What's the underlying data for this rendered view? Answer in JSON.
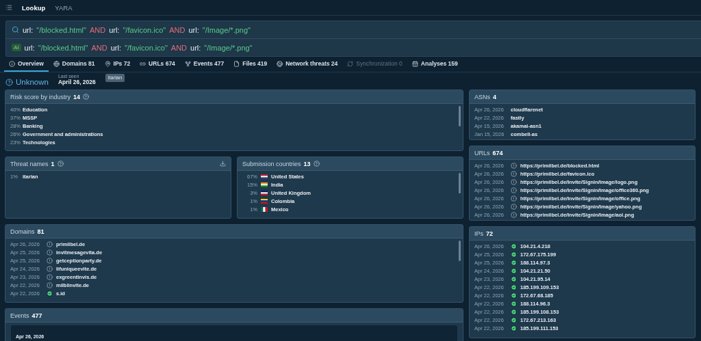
{
  "nav": {
    "tabs": [
      {
        "label": "Lookup",
        "selected": true
      },
      {
        "label": "YARA",
        "selected": false
      }
    ]
  },
  "query": [
    {
      "kind": "field",
      "text": "url:"
    },
    {
      "kind": "value",
      "text": "\"/blocked.html\""
    },
    {
      "kind": "op",
      "text": "AND"
    },
    {
      "kind": "field",
      "text": "url:"
    },
    {
      "kind": "value",
      "text": "\"/favicon.ico\""
    },
    {
      "kind": "op",
      "text": "AND"
    },
    {
      "kind": "field",
      "text": "url:"
    },
    {
      "kind": "value",
      "text": "\"/Image/*.png\""
    }
  ],
  "suggestion": {
    "badge": "AI",
    "tokens": [
      {
        "kind": "field",
        "text": "url:"
      },
      {
        "kind": "value",
        "text": "\"/blocked.html\""
      },
      {
        "kind": "op",
        "text": "AND"
      },
      {
        "kind": "field",
        "text": "url:"
      },
      {
        "kind": "value",
        "text": "\"/favicon.ico\""
      },
      {
        "kind": "op",
        "text": "AND"
      },
      {
        "kind": "field",
        "text": "url:"
      },
      {
        "kind": "value",
        "text": "\"/Image/*.png\""
      }
    ]
  },
  "tabs": [
    {
      "label": "Overview",
      "selected": true,
      "disabled": false
    },
    {
      "label": "Domains 81",
      "selected": false,
      "disabled": false
    },
    {
      "label": "IPs 72",
      "selected": false,
      "disabled": false
    },
    {
      "label": "URLs 674",
      "selected": false,
      "disabled": false
    },
    {
      "label": "Events 477",
      "selected": false,
      "disabled": false
    },
    {
      "label": "Files 419",
      "selected": false,
      "disabled": false
    },
    {
      "label": "Network threats 24",
      "selected": false,
      "disabled": false
    },
    {
      "label": "Synchronization 0",
      "selected": false,
      "disabled": true
    },
    {
      "label": "Analyses 159",
      "selected": false,
      "disabled": false
    }
  ],
  "summary": {
    "verdict": "Unknown",
    "last_seen_label": "Last seen",
    "last_seen": "April 26, 2026",
    "tag": "itarian"
  },
  "risk": {
    "title": "Risk score by industry",
    "count": "14",
    "rows": [
      {
        "pct": "40%",
        "name": "Education"
      },
      {
        "pct": "37%",
        "name": "MSSP"
      },
      {
        "pct": "28%",
        "name": "Banking"
      },
      {
        "pct": "26%",
        "name": "Government and administrations"
      },
      {
        "pct": "23%",
        "name": "Technologies"
      }
    ]
  },
  "threat_names": {
    "title": "Threat names",
    "count": "1",
    "rows": [
      {
        "pct": "1%",
        "name": "itarian"
      }
    ]
  },
  "countries": {
    "title": "Submission countries",
    "count": "13",
    "rows": [
      {
        "pct": "67%",
        "name": "United States"
      },
      {
        "pct": "15%",
        "name": "India"
      },
      {
        "pct": "3%",
        "name": "United Kingdom"
      },
      {
        "pct": "1%",
        "name": "Colombia"
      },
      {
        "pct": "1%",
        "name": "Mexico"
      }
    ]
  },
  "domains": {
    "title": "Domains",
    "count": "81",
    "rows": [
      {
        "date": "Apr 26, 2026",
        "clean": false,
        "name": "primilbel.de"
      },
      {
        "date": "Apr 25, 2026",
        "clean": false,
        "name": "invitmesagevita.de"
      },
      {
        "date": "Apr 25, 2026",
        "clean": false,
        "name": "getceptionparty.de"
      },
      {
        "date": "Apr 24, 2026",
        "clean": false,
        "name": "lifuniqueevite.de"
      },
      {
        "date": "Apr 23, 2026",
        "clean": false,
        "name": "exgreentinvis.de"
      },
      {
        "date": "Apr 22, 2026",
        "clean": false,
        "name": "milblinvite.de"
      },
      {
        "date": "Apr 22, 2026",
        "clean": true,
        "name": "s.id"
      }
    ]
  },
  "events": {
    "title": "Events",
    "count": "477",
    "first_date": "Apr 26, 2026"
  },
  "asns": {
    "title": "ASNs",
    "count": "4",
    "rows": [
      {
        "date": "Apr 26, 2026",
        "name": "cloudflarenet"
      },
      {
        "date": "Apr 22, 2026",
        "name": "fastly"
      },
      {
        "date": "Apr 15, 2026",
        "name": "akamai-asn1"
      },
      {
        "date": "Jan 15, 2026",
        "name": "combell-as"
      }
    ]
  },
  "urls": {
    "title": "URLs",
    "count": "674",
    "rows": [
      {
        "date": "Apr 26, 2026",
        "clean": false,
        "name": "https://primilbel.de/blocked.html"
      },
      {
        "date": "Apr 26, 2026",
        "clean": false,
        "name": "https://primilbel.de/favicon.ico"
      },
      {
        "date": "Apr 26, 2026",
        "clean": false,
        "name": "https://primilbel.de/Invite/Signin/Image/logo.png"
      },
      {
        "date": "Apr 26, 2026",
        "clean": false,
        "name": "https://primilbel.de/Invite/Signin/Image/office360.png"
      },
      {
        "date": "Apr 26, 2026",
        "clean": false,
        "name": "https://primilbel.de/Invite/Signin/Image/office.png"
      },
      {
        "date": "Apr 26, 2026",
        "clean": false,
        "name": "https://primilbel.de/Invite/Signin/Image/yahoo.png"
      },
      {
        "date": "Apr 26, 2026",
        "clean": false,
        "name": "https://primilbel.de/Invite/Signin/Image/aol.png"
      }
    ]
  },
  "ips": {
    "title": "IPs",
    "count": "72",
    "rows": [
      {
        "date": "Apr 26, 2026",
        "clean": true,
        "name": "104.21.4.218"
      },
      {
        "date": "Apr 25, 2026",
        "clean": true,
        "name": "172.67.175.199"
      },
      {
        "date": "Apr 25, 2026",
        "clean": true,
        "name": "188.114.97.3"
      },
      {
        "date": "Apr 24, 2026",
        "clean": true,
        "name": "104.21.21.50"
      },
      {
        "date": "Apr 23, 2026",
        "clean": true,
        "name": "104.21.95.14"
      },
      {
        "date": "Apr 22, 2026",
        "clean": true,
        "name": "185.199.109.153"
      },
      {
        "date": "Apr 22, 2026",
        "clean": true,
        "name": "172.67.68.185"
      },
      {
        "date": "Apr 22, 2026",
        "clean": true,
        "name": "188.114.96.3"
      },
      {
        "date": "Apr 22, 2026",
        "clean": true,
        "name": "185.199.108.153"
      },
      {
        "date": "Apr 22, 2026",
        "clean": true,
        "name": "172.67.213.163"
      },
      {
        "date": "Apr 22, 2026",
        "clean": true,
        "name": "185.199.111.153"
      }
    ]
  }
}
